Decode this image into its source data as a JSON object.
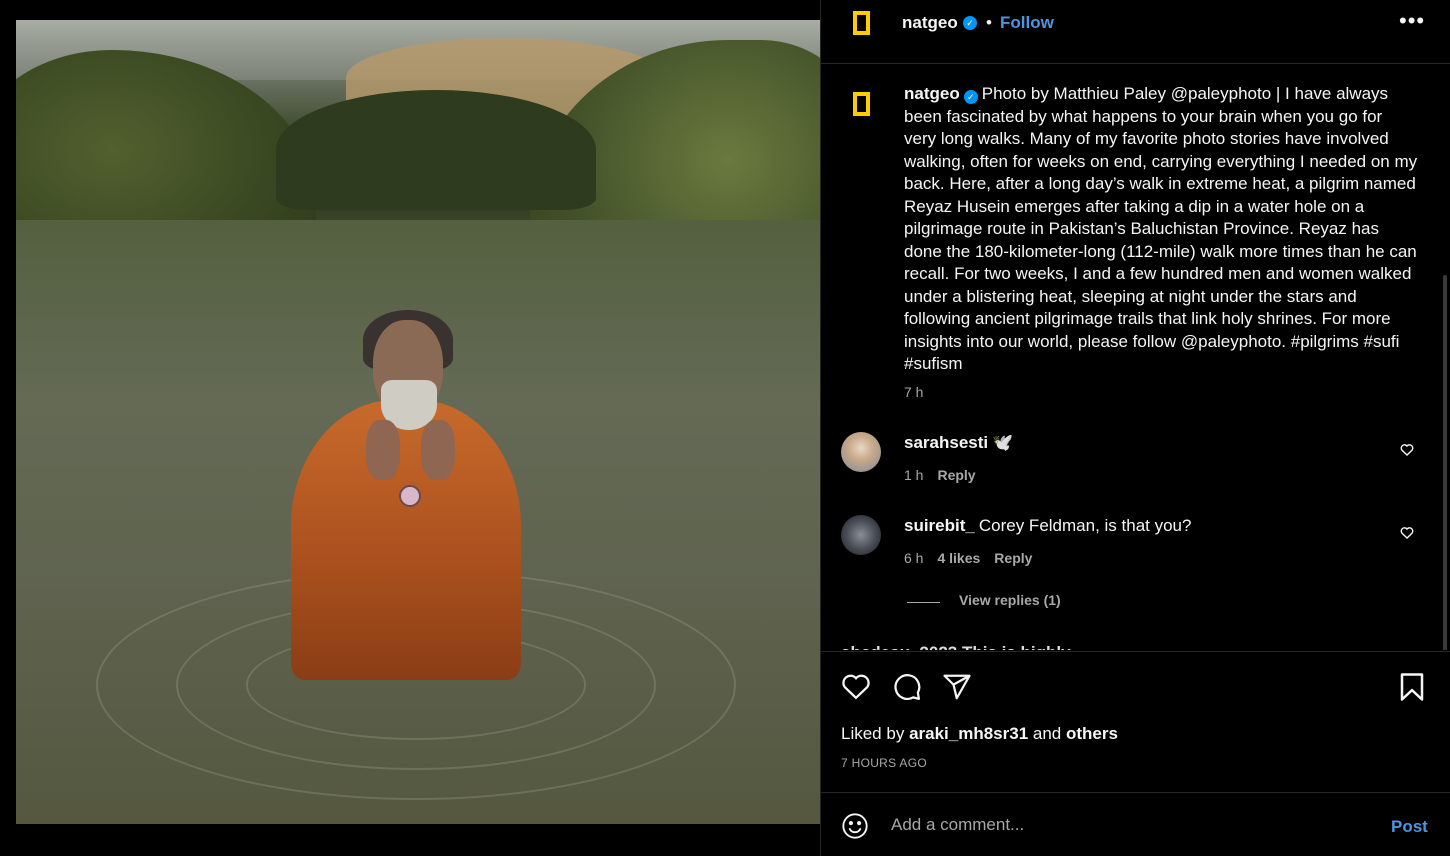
{
  "header": {
    "username": "natgeo",
    "verified": true,
    "separator": "•",
    "follow_label": "Follow",
    "more_label": "•••"
  },
  "photo": {
    "description_icon": "photo"
  },
  "caption": {
    "username": "natgeo",
    "text": "Photo by Matthieu Paley @paleyphoto | I have always been fascinated by what happens to your brain when you go for very long walks. Many of my favorite photo stories have involved walking, often for weeks on end, carrying everything I needed on my back. Here, after a long day’s walk in extreme heat, a pilgrim named Reyaz Husein emerges after taking a dip in a water hole on a pilgrimage route in Pakistan’s Baluchistan Province. Reyaz has done the 180-kilometer-long (112-mile) walk more times than he can recall. For two weeks, I and a few hundred men and women walked under a blistering heat, sleeping at night under the stars and following ancient pilgrimage trails that link holy shrines. For more insights into our world, please follow @paleyphoto. #pilgrims #sufi #sufism",
    "time": "7 h"
  },
  "comments": [
    {
      "username": "sarahsesti",
      "text": "🕊️",
      "time": "1 h",
      "likes": "",
      "reply_label": "Reply"
    },
    {
      "username": "suirebit_",
      "text": "Corey Feldman, is that you?",
      "time": "6 h",
      "likes": "4 likes",
      "reply_label": "Reply"
    }
  ],
  "view_replies_label": "View replies (1)",
  "partial_comment": "abcdesu_2023 This is highly ...",
  "actions": {
    "liked_by_prefix": "Liked by",
    "liked_by_user": "araki_mh8sr31",
    "liked_by_and": "and",
    "liked_by_others": "others",
    "posted_ago": "7 HOURS AGO"
  },
  "composer": {
    "placeholder": "Add a comment...",
    "post_label": "Post"
  },
  "colors": {
    "accent": "#4a95e0",
    "logo_yellow": "#ffcc00",
    "verified_blue": "#0095f6"
  }
}
